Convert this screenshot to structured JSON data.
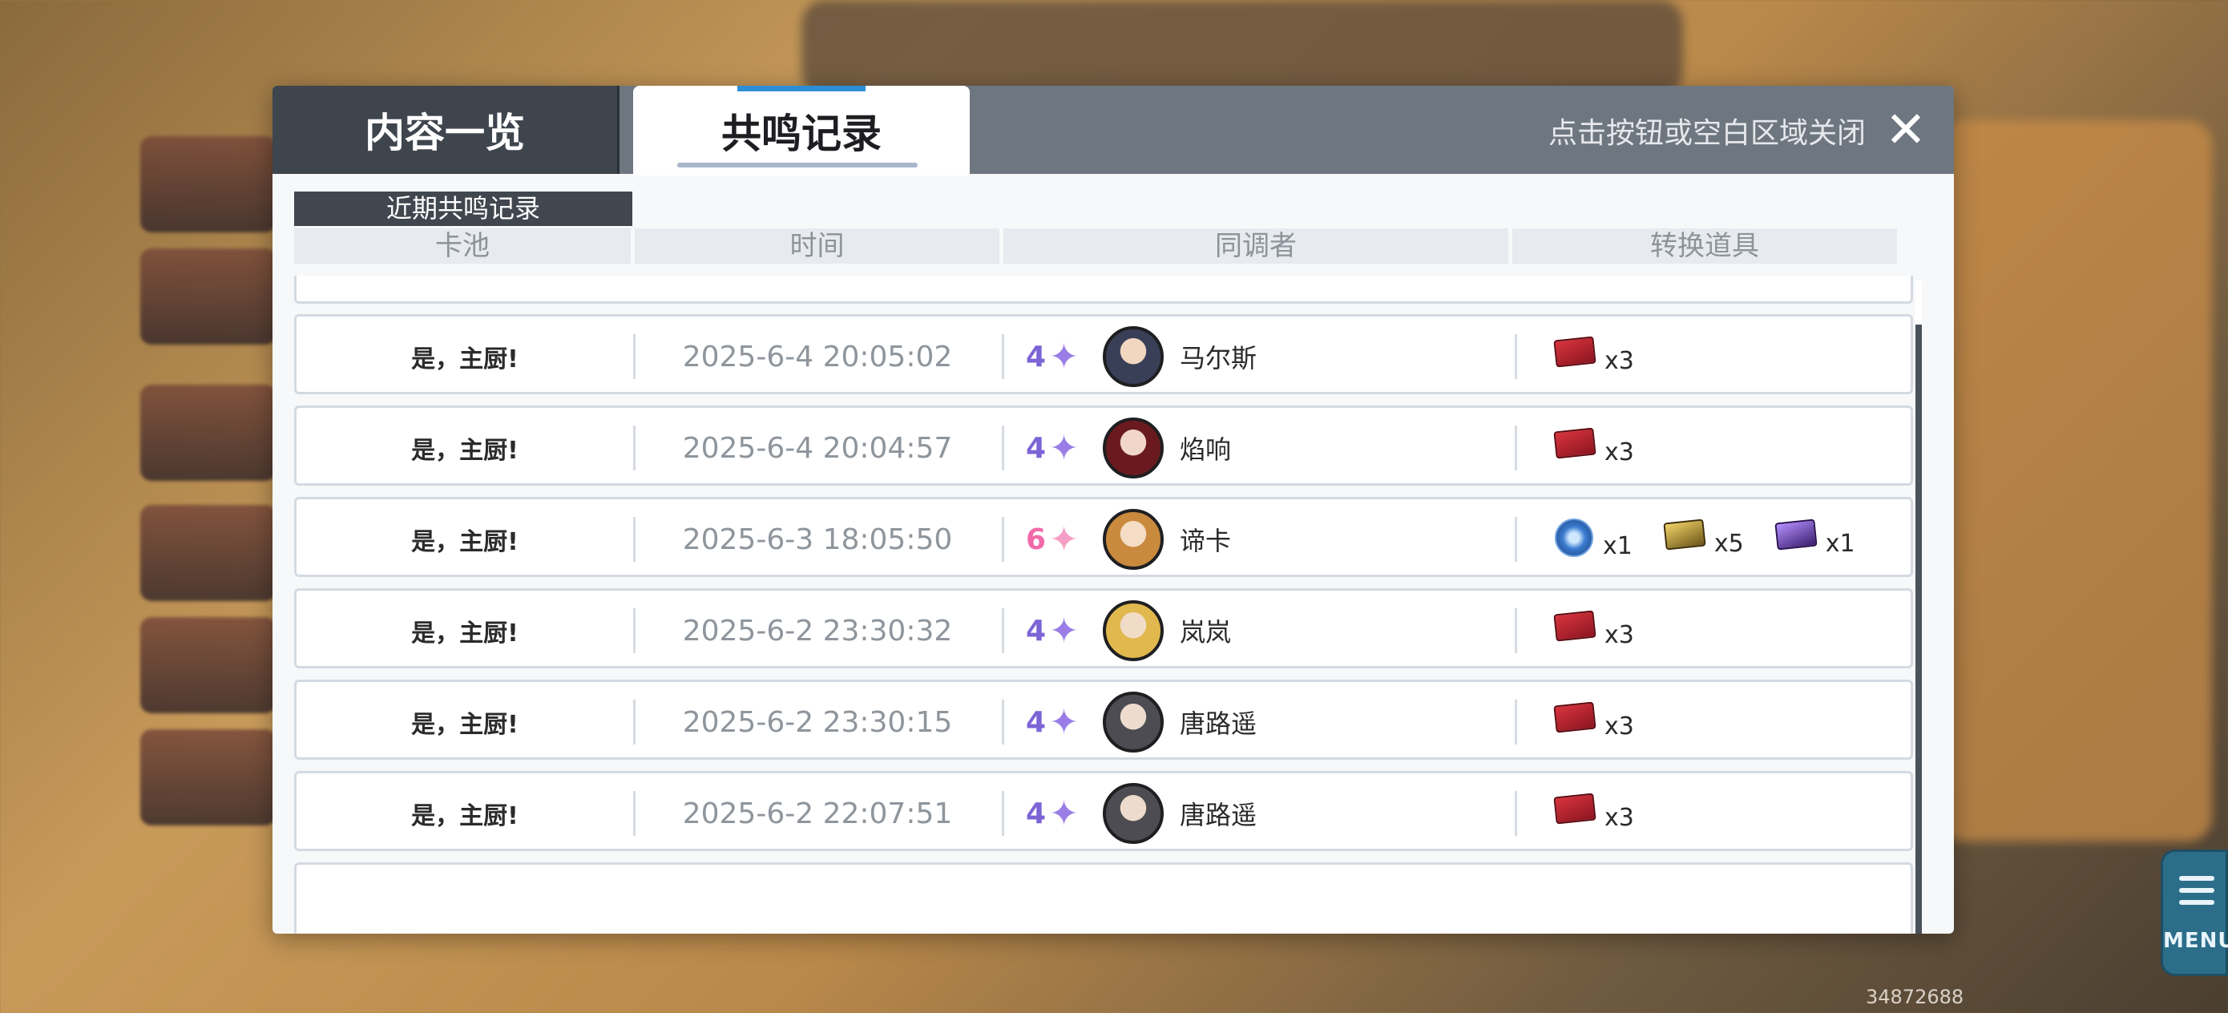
{
  "dialog": {
    "tabs": [
      {
        "label": "内容一览",
        "active": false
      },
      {
        "label": "共鸣记录",
        "active": true
      }
    ],
    "close_hint": "点击按钮或空白区域关闭",
    "section_label": "近期共鸣记录",
    "columns": [
      "卡池",
      "时间",
      "同调者",
      "转换道具"
    ]
  },
  "records": [
    {
      "pool": "是，主厨!",
      "time": "2025-6-4   20:05:02",
      "rarity": "4",
      "name": "马尔斯",
      "items": [
        {
          "icon": "red-ticket-icon",
          "qty": "x3"
        }
      ]
    },
    {
      "pool": "是，主厨!",
      "time": "2025-6-4   20:04:57",
      "rarity": "4",
      "name": "焰响",
      "items": [
        {
          "icon": "red-ticket-icon",
          "qty": "x3"
        }
      ]
    },
    {
      "pool": "是，主厨!",
      "time": "2025-6-3   18:05:50",
      "rarity": "6",
      "name": "谛卡",
      "items": [
        {
          "icon": "blue-orb-icon",
          "qty": "x1"
        },
        {
          "icon": "gold-card-icon",
          "qty": "x5"
        },
        {
          "icon": "purple-card-icon",
          "qty": "x1"
        }
      ]
    },
    {
      "pool": "是，主厨!",
      "time": "2025-6-2   23:30:32",
      "rarity": "4",
      "name": "岚岚",
      "items": [
        {
          "icon": "red-ticket-icon",
          "qty": "x3"
        }
      ]
    },
    {
      "pool": "是，主厨!",
      "time": "2025-6-2   23:30:15",
      "rarity": "4",
      "name": "唐路遥",
      "items": [
        {
          "icon": "red-ticket-icon",
          "qty": "x3"
        }
      ]
    },
    {
      "pool": "是，主厨!",
      "time": "2025-6-2   22:07:51",
      "rarity": "4",
      "name": "唐路遥",
      "items": [
        {
          "icon": "red-ticket-icon",
          "qty": "x3"
        }
      ]
    }
  ],
  "menu_label": "MENU",
  "uid": "34872688",
  "colors": {
    "rarity4": "#7c64d6",
    "rarity6": "#f26aa9",
    "header_dark": "#3e454d",
    "accent": "#2d8ed8"
  }
}
